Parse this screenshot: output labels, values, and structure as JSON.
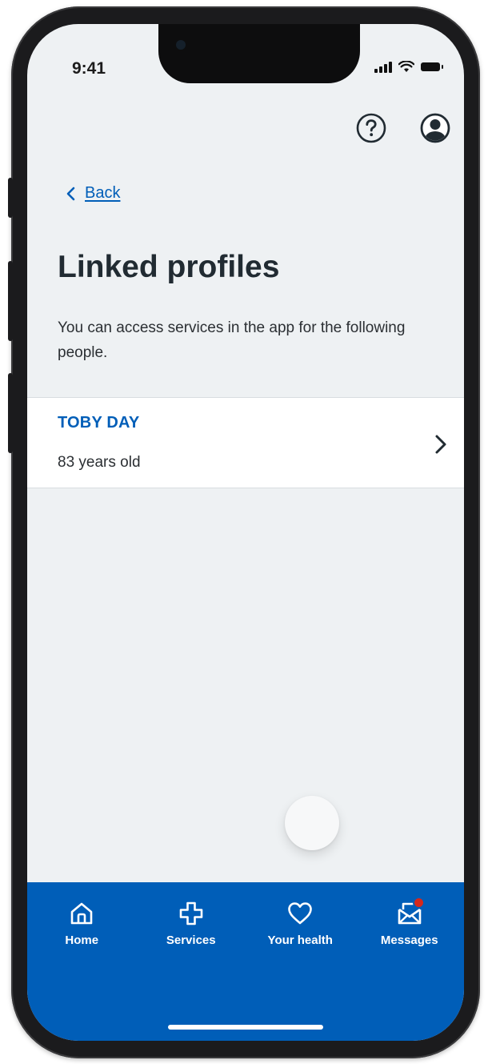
{
  "status_bar": {
    "time": "9:41"
  },
  "header": {
    "help_icon": "question-circle-icon",
    "profile_icon": "user-circle-icon"
  },
  "back": {
    "label": "Back"
  },
  "page": {
    "title": "Linked profiles",
    "intro": "You can access services in the app for the following people."
  },
  "profiles": [
    {
      "name": "TOBY DAY",
      "age": "83 years old"
    }
  ],
  "tab_bar": {
    "items": [
      {
        "label": "Home",
        "icon": "home-icon"
      },
      {
        "label": "Services",
        "icon": "plus-cross-icon"
      },
      {
        "label": "Your health",
        "icon": "heart-icon"
      },
      {
        "label": "Messages",
        "icon": "envelope-icon"
      }
    ]
  },
  "colors": {
    "brand_blue": "#005eb8",
    "background": "#eef1f3",
    "notification_red": "#d5281b"
  }
}
